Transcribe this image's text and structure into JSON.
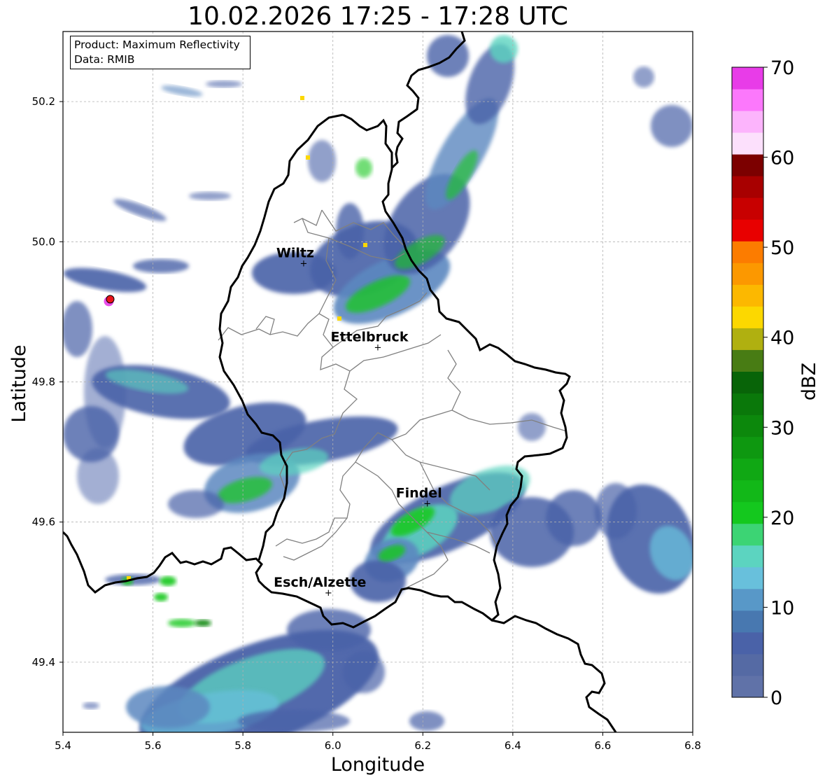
{
  "title": "10.02.2026 17:25 - 17:28 UTC",
  "info": {
    "product": "Product: Maximum Reflectivity",
    "data": "Data: RMIB"
  },
  "axes": {
    "xlabel": "Longitude",
    "ylabel": "Latitude",
    "xlim": [
      5.4,
      6.8
    ],
    "ylim": [
      49.3,
      50.3
    ],
    "xticks": [
      "5.4",
      "5.6",
      "5.8",
      "6.0",
      "6.2",
      "6.4",
      "6.6",
      "6.8"
    ],
    "yticks": [
      "49.4",
      "49.6",
      "49.8",
      "50.0",
      "50.2"
    ],
    "grid": true
  },
  "cities": [
    {
      "name": "Wiltz",
      "lon": 5.935,
      "lat": 49.97
    },
    {
      "name": "Ettelbruck",
      "lon": 6.1,
      "lat": 49.85
    },
    {
      "name": "Findel",
      "lon": 6.21,
      "lat": 49.627
    },
    {
      "name": "Esch/Alzette",
      "lon": 5.99,
      "lat": 49.5
    }
  ],
  "radar_marker": {
    "lon": 5.505,
    "lat": 49.918,
    "color": "#e8141a"
  },
  "colorbar": {
    "label": "dBZ",
    "min": 0,
    "max": 70,
    "ticks": [
      "0",
      "10",
      "20",
      "30",
      "40",
      "50",
      "60",
      "70"
    ],
    "colors": [
      "#6072a8",
      "#556aa4",
      "#4a62a8",
      "#4878b0",
      "#5898c8",
      "#68c0dc",
      "#5cd4c0",
      "#3cd474",
      "#14c81e",
      "#12b818",
      "#10a814",
      "#0e9810",
      "#0c880c",
      "#0a780a",
      "#086408",
      "#487c14",
      "#b0b010",
      "#fcd800",
      "#fcb800",
      "#fc9800",
      "#fc7c00",
      "#e80000",
      "#c80000",
      "#a80000",
      "#7c0000",
      "#fce0fc",
      "#fcb4fc",
      "#fc78fc",
      "#e83ce8"
    ]
  },
  "echo_colors": {
    "light": "#4a62a8",
    "medium": "#5c88c0",
    "cyan": "#68c0dc",
    "teal": "#5cd4c0",
    "green": "#14c81e",
    "dark_green": "#0c880c",
    "yellow": "#fcd800"
  }
}
